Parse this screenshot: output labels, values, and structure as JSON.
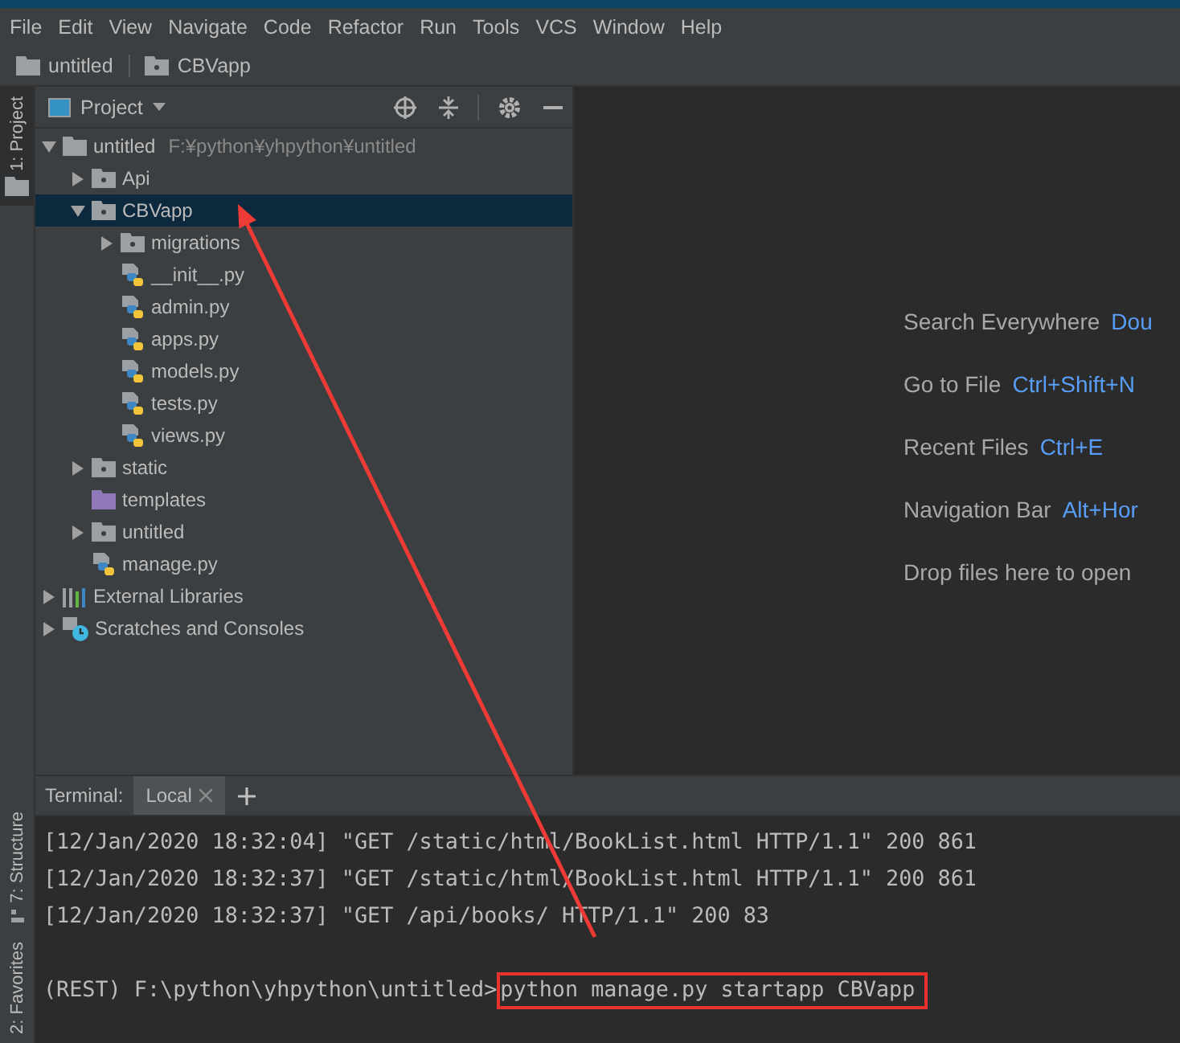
{
  "menu": [
    "File",
    "Edit",
    "View",
    "Navigate",
    "Code",
    "Refactor",
    "Run",
    "Tools",
    "VCS",
    "Window",
    "Help"
  ],
  "breadcrumb": [
    {
      "label": "untitled",
      "kind": "folder"
    },
    {
      "label": "CBVapp",
      "kind": "package"
    }
  ],
  "left_strip": [
    {
      "label": "1: Project",
      "selected": true,
      "kind": "folder"
    }
  ],
  "left_strip_bottom": [
    {
      "label": "7: Structure",
      "kind": "structure"
    },
    {
      "label": "2: Favorites",
      "kind": "plain"
    }
  ],
  "project_panel": {
    "title": "Project",
    "tree": [
      {
        "label": "untitled",
        "hint": "F:¥python¥yhpython¥untitled",
        "kind": "folder",
        "expanded": true,
        "selected": false,
        "children": [
          {
            "label": "Api",
            "kind": "package",
            "expanded": false,
            "selected": false
          },
          {
            "label": "CBVapp",
            "kind": "package",
            "expanded": true,
            "selected": true,
            "children": [
              {
                "label": "migrations",
                "kind": "package",
                "expanded": false,
                "selected": false
              },
              {
                "label": "__init__.py",
                "kind": "python",
                "selected": false
              },
              {
                "label": "admin.py",
                "kind": "python",
                "selected": false
              },
              {
                "label": "apps.py",
                "kind": "python",
                "selected": false
              },
              {
                "label": "models.py",
                "kind": "python",
                "selected": false
              },
              {
                "label": "tests.py",
                "kind": "python",
                "selected": false
              },
              {
                "label": "views.py",
                "kind": "python",
                "selected": false
              }
            ]
          },
          {
            "label": "static",
            "kind": "package",
            "expanded": false,
            "selected": false
          },
          {
            "label": "templates",
            "kind": "templates",
            "selected": false
          },
          {
            "label": "untitled",
            "kind": "package",
            "expanded": false,
            "selected": false
          },
          {
            "label": "manage.py",
            "kind": "python",
            "selected": false
          }
        ]
      },
      {
        "label": "External Libraries",
        "kind": "libraries",
        "expanded": false,
        "selected": false
      },
      {
        "label": "Scratches and Consoles",
        "kind": "scratches",
        "expanded": false,
        "selected": false
      }
    ]
  },
  "welcome": {
    "hints": [
      {
        "label": "Search Everywhere",
        "shortcut": "Dou"
      },
      {
        "label": "Go to File",
        "shortcut": "Ctrl+Shift+N"
      },
      {
        "label": "Recent Files",
        "shortcut": "Ctrl+E"
      },
      {
        "label": "Navigation Bar",
        "shortcut": "Alt+Hor"
      }
    ],
    "drop": "Drop files here to open"
  },
  "terminal": {
    "title": "Terminal:",
    "tabs": [
      {
        "label": "Local",
        "selected": true
      }
    ],
    "lines": [
      "[12/Jan/2020 18:32:04] \"GET /static/html/BookList.html HTTP/1.1\" 200 861",
      "[12/Jan/2020 18:32:37] \"GET /static/html/BookList.html HTTP/1.1\" 200 861",
      "[12/Jan/2020 18:32:37] \"GET /api/books/ HTTP/1.1\" 200 83"
    ],
    "prompt": "(REST) F:\\python\\yhpython\\untitled>",
    "command": "python manage.py startapp CBVapp",
    "command_highlighted": true
  },
  "annotation": {
    "arrow": true
  }
}
